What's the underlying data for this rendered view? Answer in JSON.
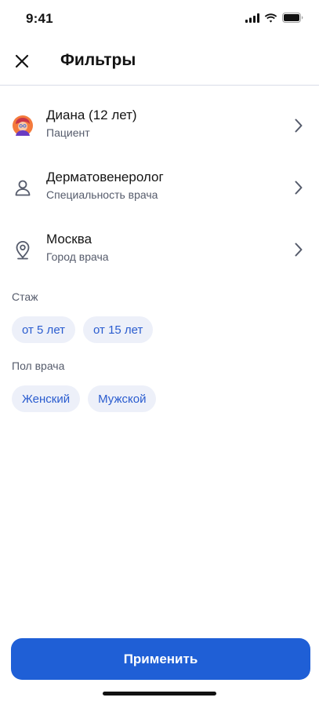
{
  "status_bar": {
    "time": "9:41",
    "icons": [
      "signal-icon",
      "wifi-icon",
      "battery-icon"
    ]
  },
  "header": {
    "close_icon": "close-icon",
    "title": "Фильтры"
  },
  "rows": [
    {
      "title": "Диана (12 лет)",
      "subtitle": "Пациент",
      "icon": "avatar"
    },
    {
      "title": "Дерматовенеролог",
      "subtitle": "Специальность врача",
      "icon": "person-icon"
    },
    {
      "title": "Москва",
      "subtitle": "Город врача",
      "icon": "location-pin-icon"
    }
  ],
  "experience": {
    "label": "Стаж",
    "options": [
      "от 5 лет",
      "от 15 лет"
    ]
  },
  "gender": {
    "label": "Пол врача",
    "options": [
      "Женский",
      "Мужской"
    ]
  },
  "apply_label": "Применить",
  "colors": {
    "accent": "#1f5fd6",
    "chip_bg": "#edf0f9",
    "chip_text": "#2a5ccf",
    "secondary_text": "#555b6b"
  }
}
